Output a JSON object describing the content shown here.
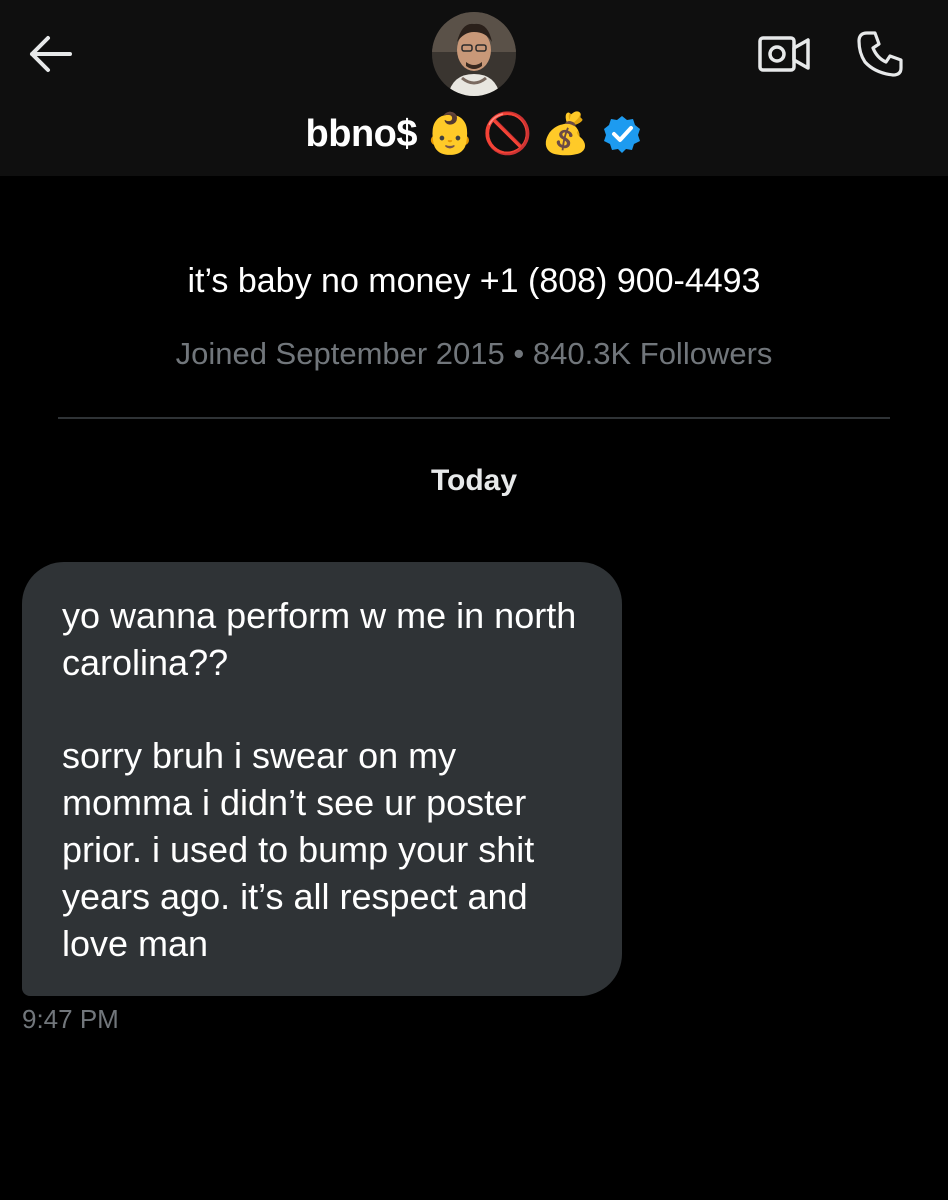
{
  "header": {
    "back_icon": "arrow-left-icon",
    "video_icon": "video-camera-icon",
    "call_icon": "phone-icon",
    "display_name": "bbno$",
    "name_emojis": [
      "👶",
      "🚫",
      "💰"
    ],
    "verified_icon": "verified-badge-icon",
    "verified_color": "#1d9bf0"
  },
  "profile": {
    "bio": "it’s baby no money +1 (808) 900-4493",
    "joined": "Joined September 2015",
    "separator": "•",
    "followers": "840.3K Followers"
  },
  "conversation": {
    "date_label": "Today",
    "messages": [
      {
        "paragraphs": [
          "yo wanna perform w me in north carolina??",
          "sorry bruh i swear on my momma i didn’t see ur poster prior. i used to bump your shit years ago. it’s all respect and love man"
        ],
        "time": "9:47 PM"
      }
    ]
  },
  "colors": {
    "background": "#000000",
    "header_bg": "#0f0f0f",
    "bubble_bg": "#2f3336",
    "muted_text": "#71767b",
    "primary_text": "#ffffff"
  }
}
